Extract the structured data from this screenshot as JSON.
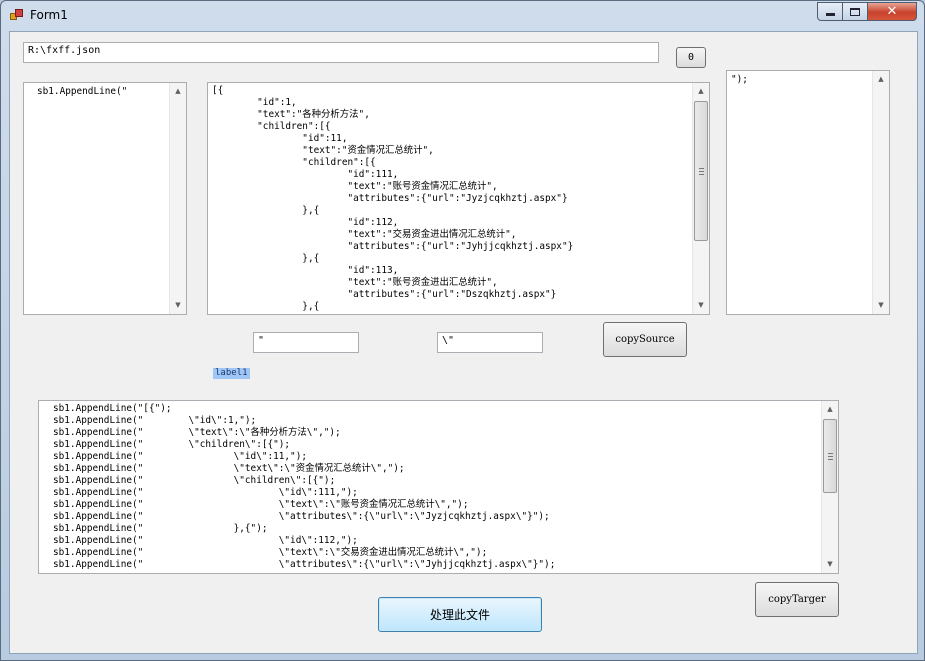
{
  "window": {
    "title": "Form1"
  },
  "path_input": {
    "value": "R:\\fxff.json"
  },
  "zero_button": {
    "label": "0"
  },
  "left_box": {
    "text": "sb1.AppendLine(\""
  },
  "source_box": {
    "lines": [
      "[{",
      "        \"id\":1,",
      "        \"text\":\"各种分析方法\",",
      "        \"children\":[{",
      "                \"id\":11,",
      "                \"text\":\"资金情况汇总统计\",",
      "                \"children\":[{",
      "                        \"id\":111,",
      "                        \"text\":\"账号资金情况汇总统计\",",
      "                        \"attributes\":{\"url\":\"Jyzjcqkhztj.aspx\"}",
      "                },{",
      "                        \"id\":112,",
      "                        \"text\":\"交易资金进出情况汇总统计\",",
      "                        \"attributes\":{\"url\":\"Jyhjjcqkhztj.aspx\"}",
      "                },{",
      "                        \"id\":113,",
      "                        \"text\":\"账号资金进出汇总统计\",",
      "                        \"attributes\":{\"url\":\"Dszqkhztj.aspx\"}",
      "                },{"
    ]
  },
  "right_box": {
    "text": "\");"
  },
  "quote_input": {
    "value": "\""
  },
  "escaped_quote_input": {
    "value": "\\\""
  },
  "copy_source_button": {
    "label": "copySource"
  },
  "label1": {
    "text": "label1"
  },
  "output_box": {
    "lines": [
      "sb1.AppendLine(\"[{\");",
      "sb1.AppendLine(\"        \\\"id\\\":1,\");",
      "sb1.AppendLine(\"        \\\"text\\\":\\\"各种分析方法\\\",\");",
      "sb1.AppendLine(\"        \\\"children\\\":[{\");",
      "sb1.AppendLine(\"                \\\"id\\\":11,\");",
      "sb1.AppendLine(\"                \\\"text\\\":\\\"资金情况汇总统计\\\",\");",
      "sb1.AppendLine(\"                \\\"children\\\":[{\");",
      "sb1.AppendLine(\"                        \\\"id\\\":111,\");",
      "sb1.AppendLine(\"                        \\\"text\\\":\\\"账号资金情况汇总统计\\\",\");",
      "sb1.AppendLine(\"                        \\\"attributes\\\":{\\\"url\\\":\\\"Jyzjcqkhztj.aspx\\\"}\");",
      "sb1.AppendLine(\"                },{\");",
      "sb1.AppendLine(\"                        \\\"id\\\":112,\");",
      "sb1.AppendLine(\"                        \\\"text\\\":\\\"交易资金进出情况汇总统计\\\",\");",
      "sb1.AppendLine(\"                        \\\"attributes\\\":{\\\"url\\\":\\\"Jyhjjcqkhztj.aspx\\\"}\");"
    ]
  },
  "process_button": {
    "label": "处理此文件"
  },
  "copy_target_button": {
    "label": "copyTarger"
  }
}
